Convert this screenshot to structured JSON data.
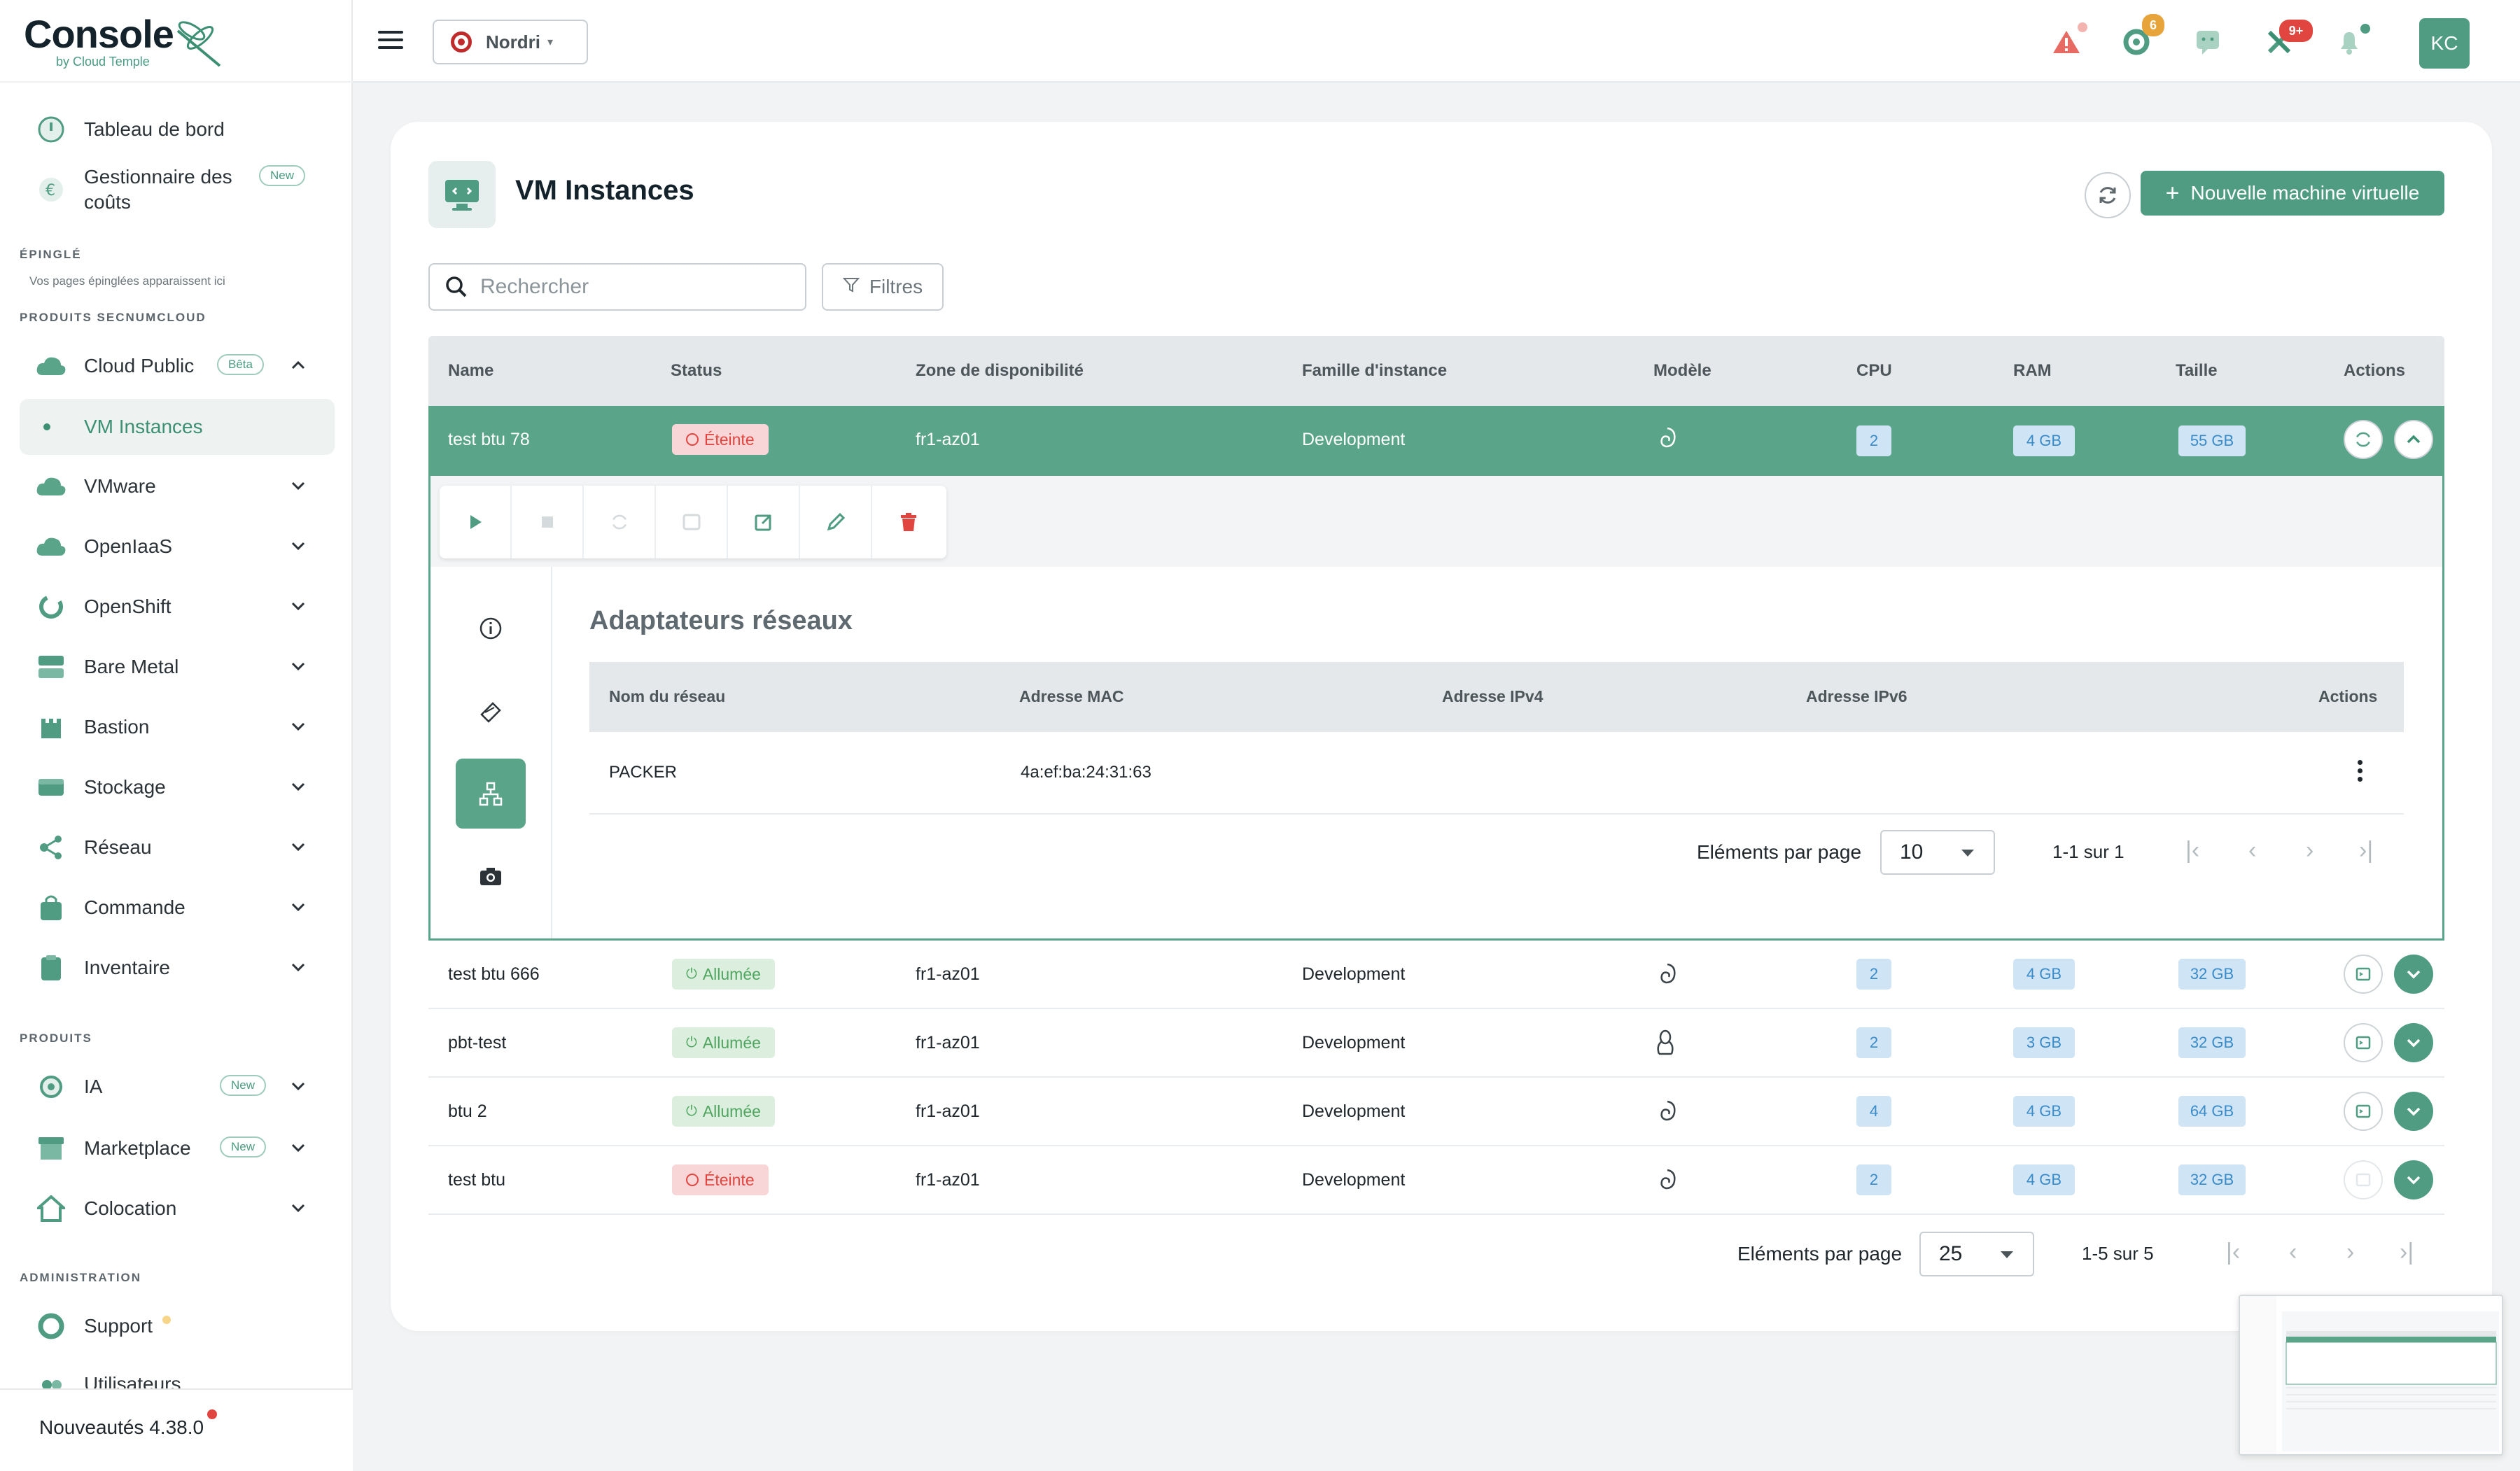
{
  "app": {
    "logo_text": "Console",
    "logo_sub": "by Cloud Temple"
  },
  "sidebar": {
    "top_items": [
      {
        "label": "Tableau de bord",
        "icon": "dashboard-icon"
      },
      {
        "label": "Gestionnaire des coûts",
        "icon": "euro-icon",
        "badge": "New"
      }
    ],
    "pinned_title": "ÉPINGLÉ",
    "pinned_hint": "Vos pages épinglées apparaissent ici",
    "secnum_title": "PRODUITS SECNUMCLOUD",
    "secnum_items": [
      {
        "label": "Cloud Public",
        "icon": "cloud-icon",
        "badge": "Bêta",
        "expanded": true
      },
      {
        "label": "VM Instances",
        "sub": true,
        "active": true
      },
      {
        "label": "VMware",
        "icon": "cloud-icon"
      },
      {
        "label": "OpenIaaS",
        "icon": "cloud-icon"
      },
      {
        "label": "OpenShift",
        "icon": "openshift-icon"
      },
      {
        "label": "Bare Metal",
        "icon": "server-icon"
      },
      {
        "label": "Bastion",
        "icon": "castle-icon"
      },
      {
        "label": "Stockage",
        "icon": "storage-icon"
      },
      {
        "label": "Réseau",
        "icon": "network-icon"
      },
      {
        "label": "Commande",
        "icon": "bag-icon"
      },
      {
        "label": "Inventaire",
        "icon": "clipboard-icon"
      }
    ],
    "products_title": "PRODUITS",
    "products_items": [
      {
        "label": "IA",
        "icon": "ai-icon",
        "badge": "New"
      },
      {
        "label": "Marketplace",
        "icon": "store-icon",
        "badge": "New"
      },
      {
        "label": "Colocation",
        "icon": "home-icon"
      }
    ],
    "admin_title": "ADMINISTRATION",
    "admin_items": [
      {
        "label": "Support",
        "icon": "lifebuoy-icon"
      },
      {
        "label": "Utilisateurs",
        "icon": "users-icon"
      }
    ],
    "news_label": "Nouveautés 4.38.0"
  },
  "topbar": {
    "tenant": "Nordri",
    "badges": {
      "extension": "6",
      "tools": "9+"
    },
    "avatar": "KC"
  },
  "page": {
    "title": "VM Instances",
    "new_vm_label": "Nouvelle machine virtuelle",
    "search_placeholder": "Rechercher",
    "filters_label": "Filtres"
  },
  "table": {
    "columns": [
      "Name",
      "Status",
      "Zone de disponibilité",
      "Famille d'instance",
      "Modèle",
      "CPU",
      "RAM",
      "Taille",
      "Actions"
    ],
    "rows": [
      {
        "name": "test btu 78",
        "status": "Éteinte",
        "zone": "fr1-az01",
        "family": "Development",
        "model": "debian",
        "cpu": "2",
        "ram": "4 GB",
        "size": "55 GB"
      },
      {
        "name": "test btu 666",
        "status": "Allumée",
        "zone": "fr1-az01",
        "family": "Development",
        "model": "debian",
        "cpu": "2",
        "ram": "4 GB",
        "size": "32 GB"
      },
      {
        "name": "pbt-test",
        "status": "Allumée",
        "zone": "fr1-az01",
        "family": "Development",
        "model": "linux",
        "cpu": "2",
        "ram": "3 GB",
        "size": "32 GB"
      },
      {
        "name": "btu 2",
        "status": "Allumée",
        "zone": "fr1-az01",
        "family": "Development",
        "model": "debian",
        "cpu": "4",
        "ram": "4 GB",
        "size": "64 GB"
      },
      {
        "name": "test btu",
        "status": "Éteinte",
        "zone": "fr1-az01",
        "family": "Development",
        "model": "debian",
        "cpu": "2",
        "ram": "4 GB",
        "size": "32 GB"
      }
    ],
    "pagination": {
      "per_page_label": "Eléments par page",
      "per_page": "25",
      "range": "1-5 sur 5"
    }
  },
  "detail": {
    "section_title": "Adaptateurs réseaux",
    "columns": [
      "Nom du réseau",
      "Adresse MAC",
      "Adresse IPv4",
      "Adresse IPv6",
      "Actions"
    ],
    "rows": [
      {
        "network": "PACKER",
        "mac": "4a:ef:ba:24:31:63",
        "ipv4": "",
        "ipv6": ""
      }
    ],
    "pagination": {
      "per_page_label": "Eléments par page",
      "per_page": "10",
      "range": "1-1 sur 1"
    }
  },
  "colors": {
    "accent": "#4f9c83",
    "selected_row": "#5aa48a",
    "off_bg": "#f8d5d6",
    "off_text": "#e0463f",
    "on_bg": "#dcefdf",
    "on_text": "#4fa55f",
    "pill_bg": "#cfe4f4",
    "pill_text": "#3a8bc9"
  }
}
